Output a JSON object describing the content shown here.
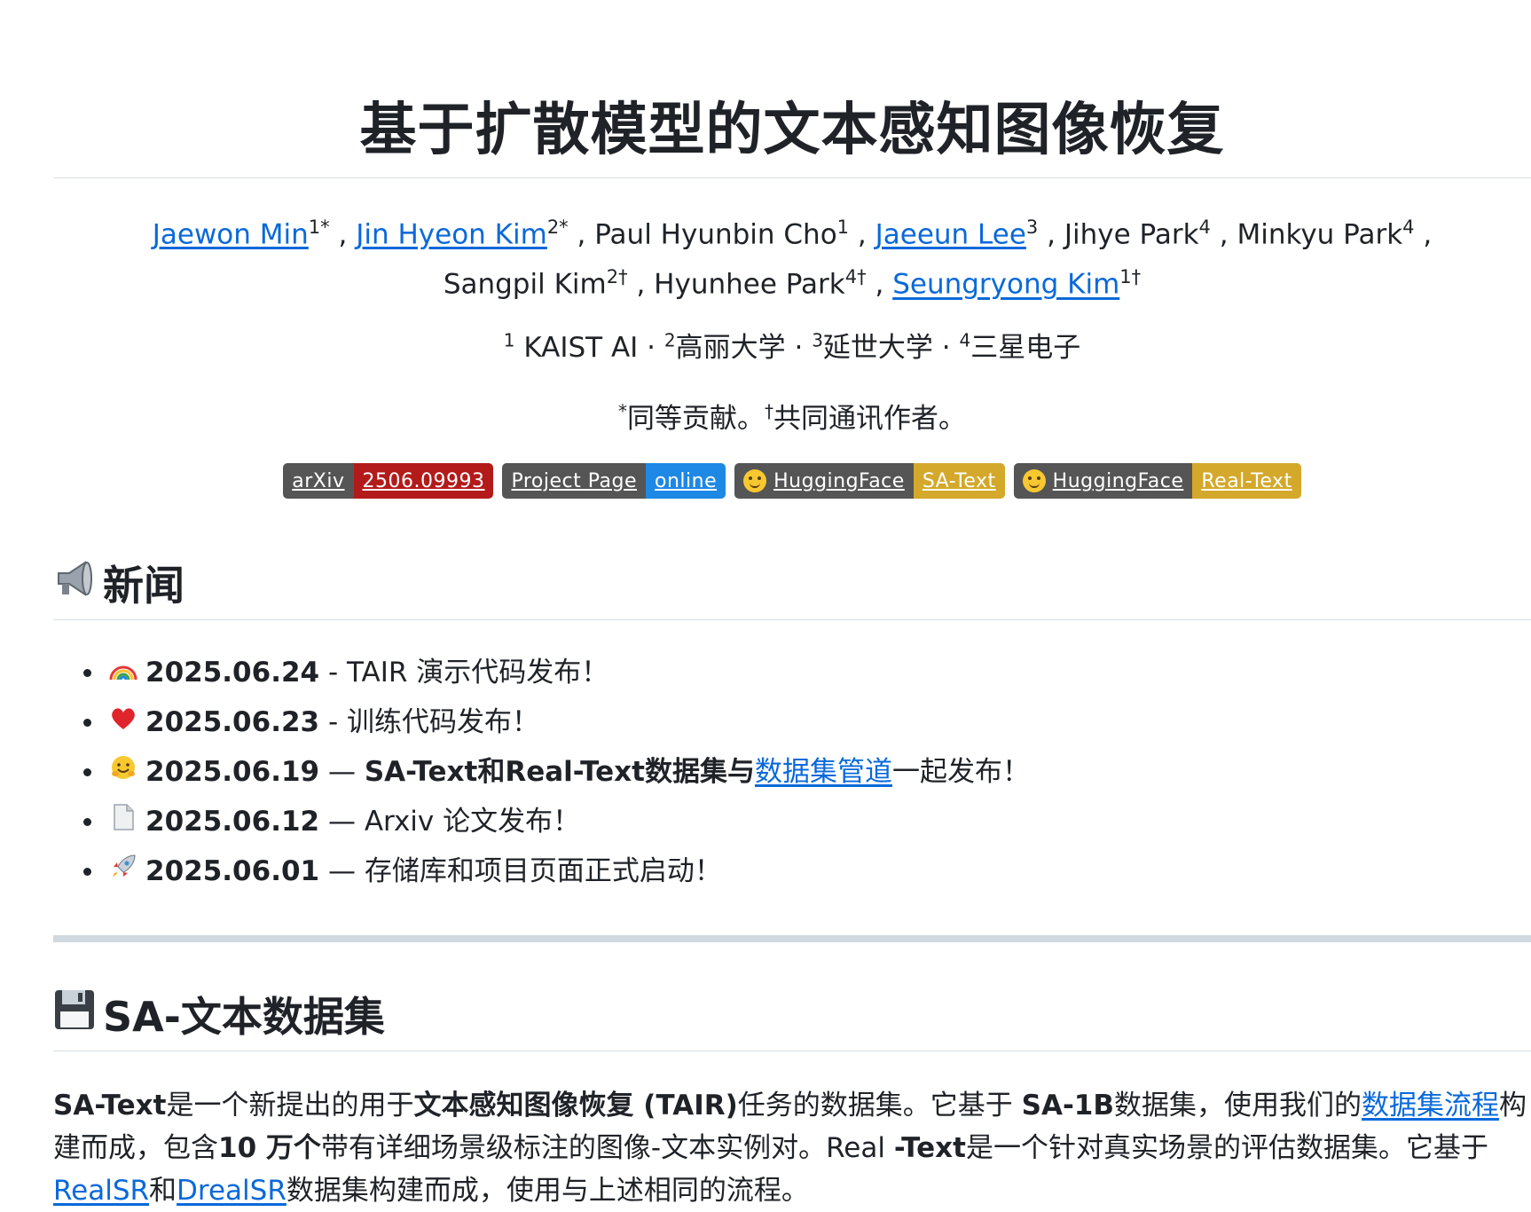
{
  "title": "基于扩散模型的文本感知图像恢复",
  "authors": {
    "a1": "Jaewon Min",
    "s1": "1*",
    "a2": "Jin Hyeon Kim",
    "s2": "2*",
    "a3": "Paul Hyunbin Cho",
    "s3": "1",
    "a4": "Jaeeun Lee",
    "s4": "3",
    "a5": "Jihye Park",
    "s5": "4",
    "a6": "Minkyu Park",
    "s6": "4",
    "a7": "Sangpil Kim",
    "s7": "2†",
    "a8": "Hyunhee Park",
    "s8": "4†",
    "a9": "Seungryong Kim",
    "s9": "1†"
  },
  "affiliations": [
    {
      "sup": "1",
      "name": " KAIST AI"
    },
    {
      "sup": "2",
      "name": "高丽大学"
    },
    {
      "sup": "3",
      "name": "延世大学"
    },
    {
      "sup": "4",
      "name": "三星电子"
    }
  ],
  "notes": {
    "sup1": "*",
    "text1": "同等贡献。",
    "sup2": "†",
    "text2": "共同通讯作者。"
  },
  "badges": [
    {
      "left": "arXiv",
      "right": "2506.09993",
      "color": "#b31b1b"
    },
    {
      "left": "Project Page",
      "right": "online",
      "color": "#1e88e5"
    },
    {
      "left": "HuggingFace",
      "right": "SA-Text",
      "color": "#d4a82a"
    },
    {
      "left": "HuggingFace",
      "right": "Real-Text",
      "color": "#d4a82a"
    }
  ],
  "news_heading": "新闻",
  "news": [
    {
      "date": "2025.06.24",
      "sep": " - ",
      "pre": "TAIR 演示代码发布！",
      "bold": "",
      "link": "",
      "post": ""
    },
    {
      "date": "2025.06.23",
      "sep": " - ",
      "pre": "训练代码发布！",
      "bold": "",
      "link": "",
      "post": ""
    },
    {
      "date": "2025.06.19",
      "sep": " — ",
      "pre": "",
      "bold": "SA-Text和Real-Text数据集与",
      "link": "数据集管道",
      "post": "一起发布！"
    },
    {
      "date": "2025.06.12",
      "sep": " — ",
      "pre": "Arxiv 论文发布！",
      "bold": "",
      "link": "",
      "post": ""
    },
    {
      "date": "2025.06.01",
      "sep": " — ",
      "pre": "存储库和项目页面正式启动！",
      "bold": "",
      "link": "",
      "post": ""
    }
  ],
  "dataset_heading": "SA-文本数据集",
  "dataset": {
    "b1": "SA-Text",
    "t1": "是一个新提出的用于",
    "b2": "文本感知图像恢复 (TAIR)",
    "t2": "任务的数据集。它基于 ",
    "b3": "SA-1B",
    "t3": "数据集，使用我们的",
    "l1": "数据集流程",
    "t4": "构建而成，包含",
    "b4": "10 万个",
    "t5": "带有详细场景级标注的图像-文本实例对。Real ",
    "b5": "-Text",
    "t6": "是一个针对真实场景的评估数据集。它基于",
    "l2": "RealSR",
    "t7": "和",
    "l3": "DrealSR",
    "t8": "数据集构建而成，使用与上述相同的流程。"
  },
  "icons": {
    "news": "megaphone-icon",
    "dataset": "floppy-disk-icon",
    "badge": "hugging-face-icon"
  },
  "colors": {
    "link": "#0969da",
    "text": "#1f2328",
    "badge_left": "#555555"
  }
}
